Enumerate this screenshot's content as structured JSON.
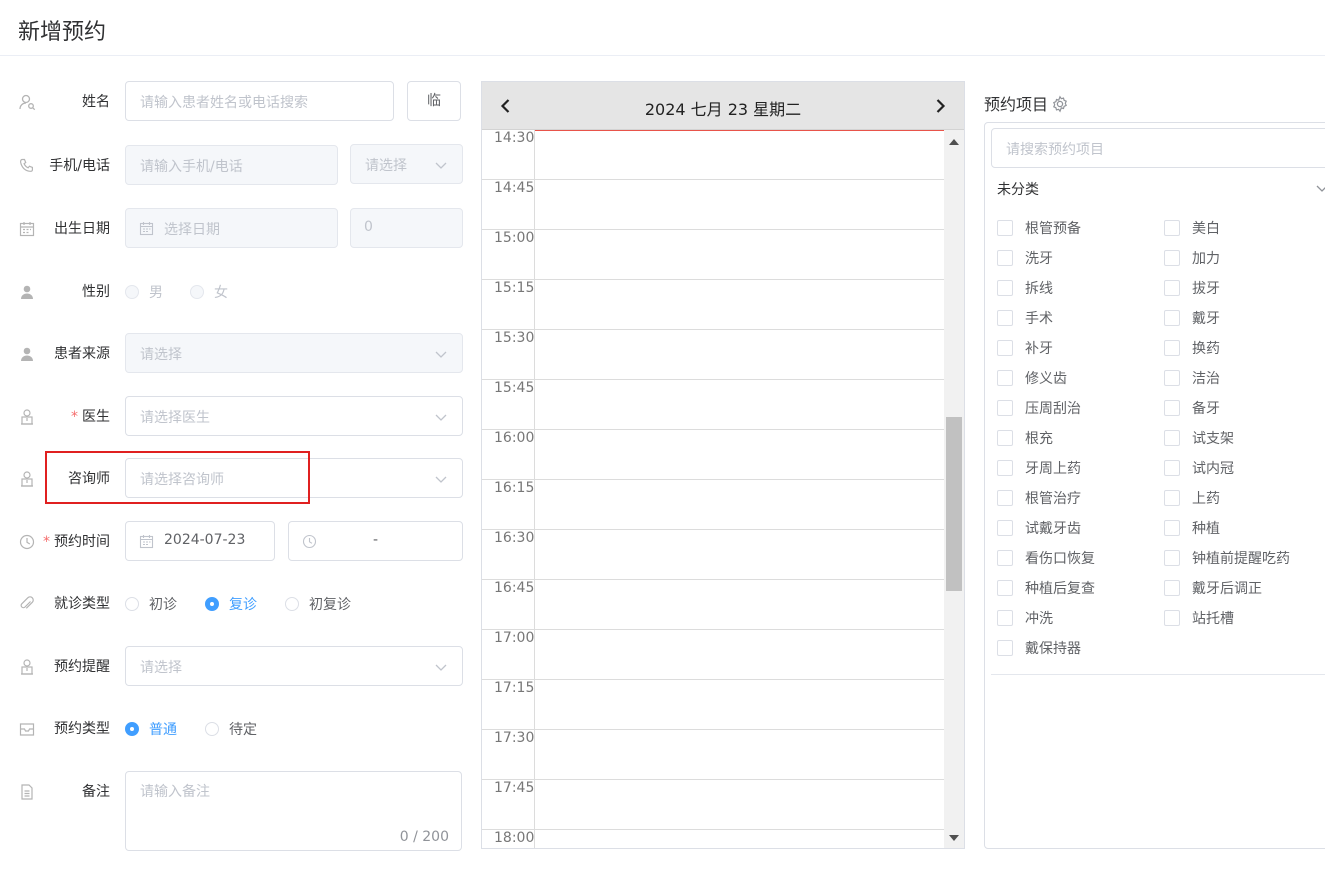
{
  "page": {
    "title": "新增预约"
  },
  "form": {
    "name": {
      "label": "姓名",
      "placeholder": "请输入患者姓名或电话搜索",
      "temp_button": "临"
    },
    "phone": {
      "label": "手机/电话",
      "placeholder": "请输入手机/电话",
      "select_placeholder": "请选择"
    },
    "birth": {
      "label": "出生日期",
      "placeholder": "选择日期",
      "age": "0"
    },
    "gender": {
      "label": "性别",
      "options": [
        "男",
        "女"
      ]
    },
    "source": {
      "label": "患者来源",
      "placeholder": "请选择"
    },
    "doctor": {
      "label": "医生",
      "required_mark": "*",
      "placeholder": "请选择医生"
    },
    "consultant": {
      "label": "咨询师",
      "placeholder": "请选择咨询师"
    },
    "appt_time": {
      "label": "预约时间",
      "required_mark": "*",
      "date": "2024-07-23",
      "time_separator": "-"
    },
    "visit_type": {
      "label": "就诊类型",
      "options": [
        "初诊",
        "复诊",
        "初复诊"
      ],
      "selected": "复诊"
    },
    "reminder": {
      "label": "预约提醒",
      "placeholder": "请选择"
    },
    "appt_type": {
      "label": "预约类型",
      "options": [
        "普通",
        "待定"
      ],
      "selected": "普通"
    },
    "notes": {
      "label": "备注",
      "placeholder": "请输入备注",
      "counter": "0 / 200"
    }
  },
  "calendar": {
    "title": "2024 七月 23 星期二",
    "slots": [
      "14:30",
      "14:45",
      "15:00",
      "15:15",
      "15:30",
      "15:45",
      "16:00",
      "16:15",
      "16:30",
      "16:45",
      "17:00",
      "17:15",
      "17:30",
      "17:45",
      "18:00"
    ]
  },
  "items": {
    "title": "预约项目",
    "search_placeholder": "请搜索预约项目",
    "category": "未分类",
    "left": [
      "根管预备",
      "洗牙",
      "拆线",
      "手术",
      "补牙",
      "修义齿",
      "压周刮治",
      "根充",
      "牙周上药",
      "根管治疗",
      "试戴牙齿",
      "看伤口恢复",
      "种植后复查",
      "冲洗",
      "戴保持器"
    ],
    "right": [
      "美白",
      "加力",
      "拔牙",
      "戴牙",
      "换药",
      "洁治",
      "备牙",
      "试支架",
      "试内冠",
      "上药",
      "种植",
      "钟植前提醒吃药",
      "戴牙后调正",
      "站托槽"
    ]
  },
  "colors": {
    "primary": "#409eff",
    "required": "#f56c6c",
    "highlight": "#e02020",
    "now_line": "#e8544a"
  }
}
